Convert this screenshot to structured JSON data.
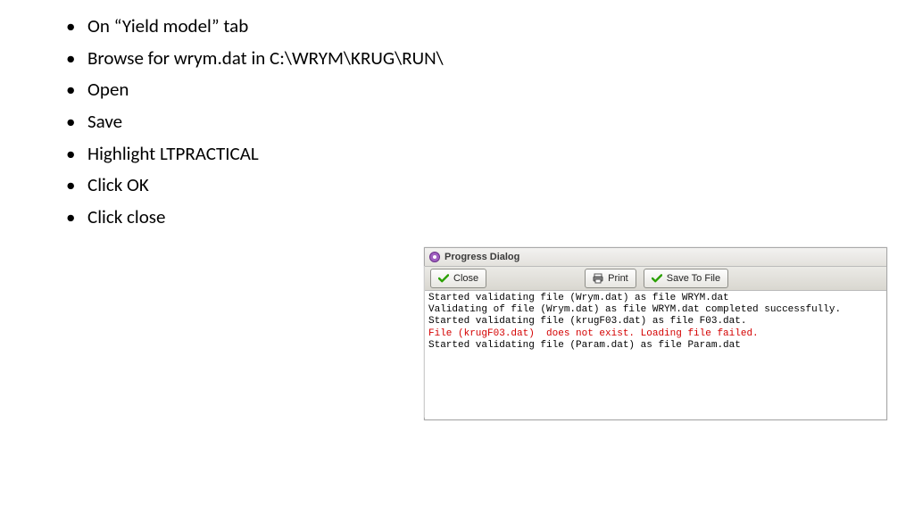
{
  "instructions": [
    "On “Yield model” tab",
    "Browse for wrym.dat in C:\\WRYM\\KRUG\\RUN\\",
    "Open",
    "Save",
    "Highlight LTPRACTICAL",
    "Click OK",
    "Click close"
  ],
  "dialog": {
    "title": "Progress Dialog",
    "buttons": {
      "close": "Close",
      "print": "Print",
      "save": "Save To File"
    },
    "log": [
      {
        "text": "Started validating file (Wrym.dat) as file WRYM.dat",
        "err": false
      },
      {
        "text": "Validating of file (Wrym.dat) as file WRYM.dat completed successfully.",
        "err": false
      },
      {
        "text": "Started validating file (krugF03.dat) as file F03.dat.",
        "err": false
      },
      {
        "text": "File (krugF03.dat)  does not exist. Loading file failed.",
        "err": true
      },
      {
        "text": "Started validating file (Param.dat) as file Param.dat",
        "err": false
      }
    ]
  }
}
